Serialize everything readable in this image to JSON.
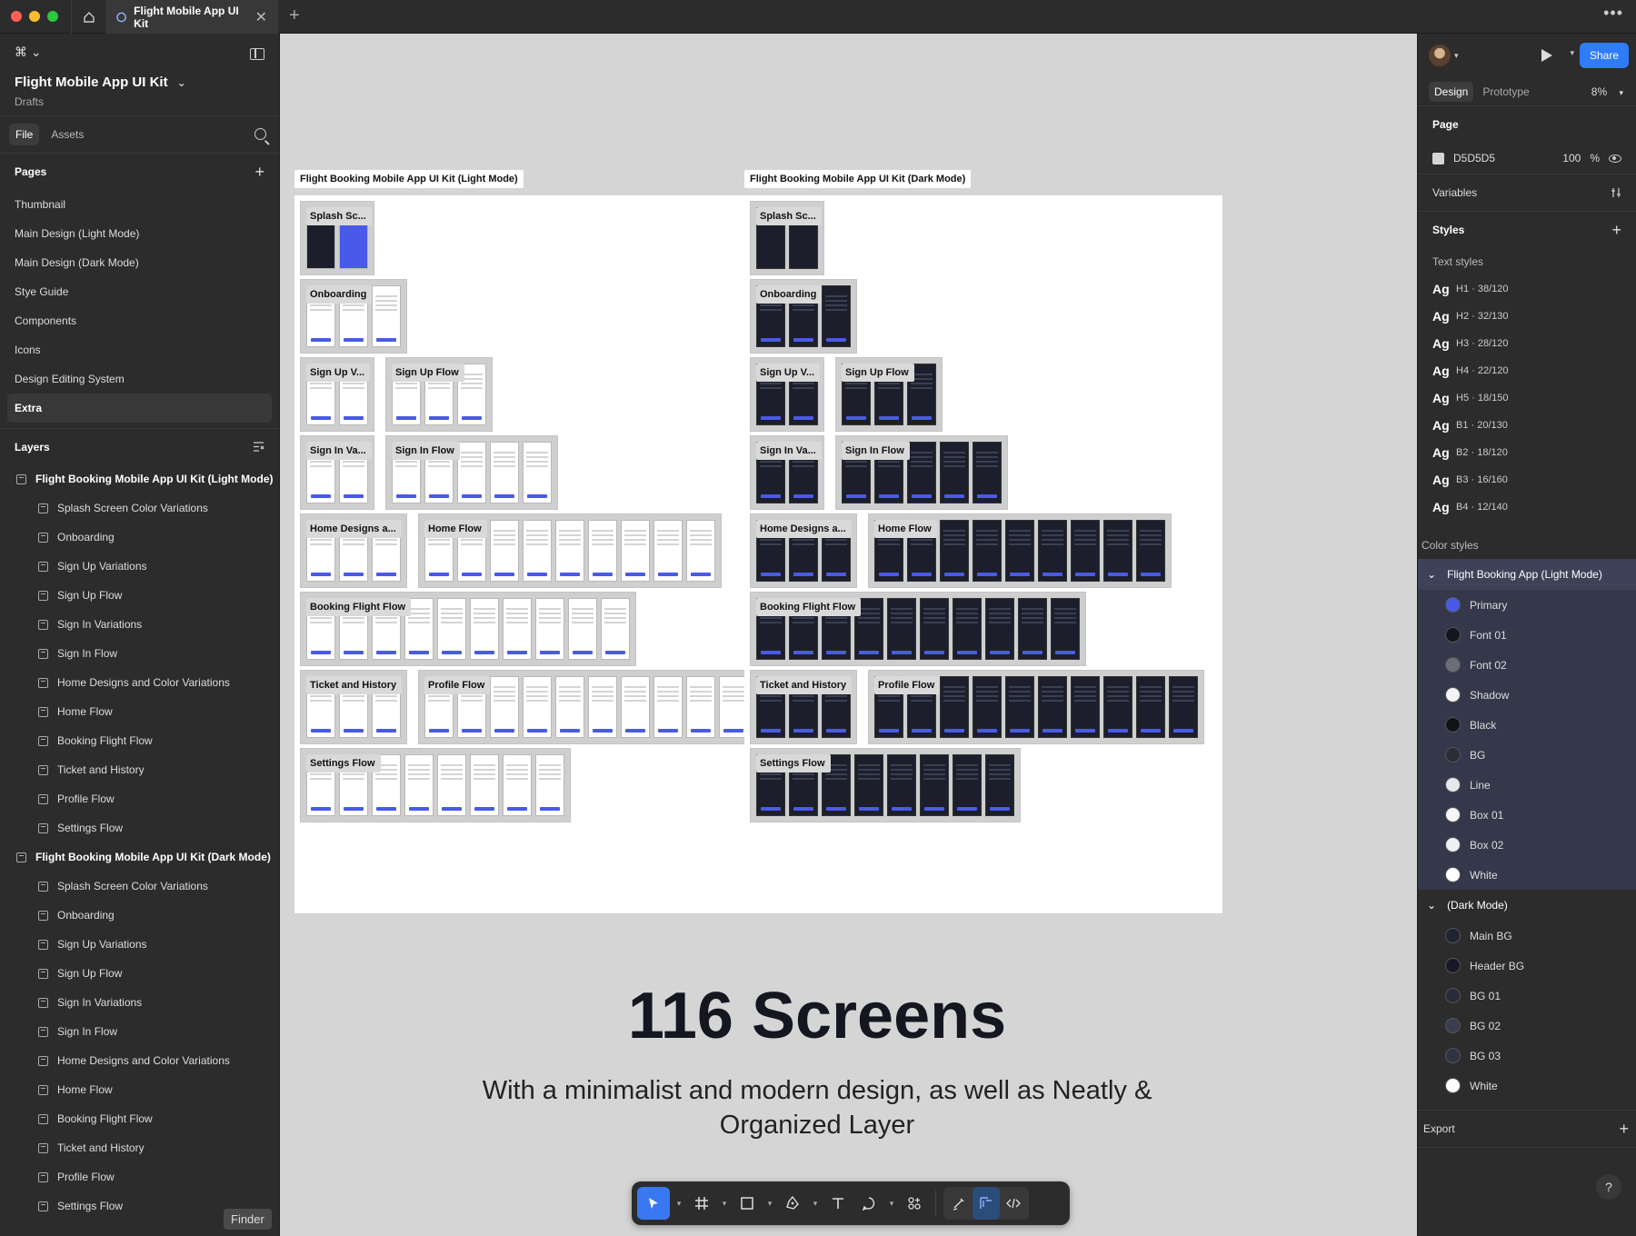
{
  "window": {
    "tab_title": "Flight Mobile App UI Kit",
    "tab_close": "✕",
    "new_tab": "+",
    "more": "•••"
  },
  "left_panel": {
    "figma_menu": "⌘ ⌄",
    "doc_title": "Flight Mobile App UI Kit",
    "doc_title_caret": "⌄",
    "doc_location": "Drafts",
    "tabs": [
      "File",
      "Assets"
    ],
    "pages_heading": "Pages",
    "pages_add": "+",
    "pages": [
      "Thumbnail",
      "Main Design (Light Mode)",
      "Main Design (Dark Mode)",
      "Stye Guide",
      "Components",
      "Icons",
      "Design Editing System",
      "Extra"
    ],
    "active_page": "Extra",
    "layers_heading": "Layers",
    "layers": [
      {
        "name": "Flight Booking Mobile App UI Kit (Light Mode)",
        "children": [
          "Splash Screen Color Variations",
          "Onboarding",
          "Sign Up Variations",
          "Sign Up Flow",
          "Sign In Variations",
          "Sign In Flow",
          "Home Designs and Color Variations",
          "Home Flow",
          "Booking Flight Flow",
          "Ticket and History",
          "Profile Flow",
          "Settings Flow"
        ]
      },
      {
        "name": "Flight Booking Mobile App UI Kit (Dark Mode)",
        "children": [
          "Splash Screen Color Variations",
          "Onboarding",
          "Sign Up Variations",
          "Sign Up Flow",
          "Sign In Variations",
          "Sign In Flow",
          "Home Designs and Color Variations",
          "Home Flow",
          "Booking Flight Flow",
          "Ticket and History",
          "Profile Flow",
          "Settings Flow"
        ]
      }
    ],
    "tooltip": "Finder"
  },
  "canvas": {
    "boards": [
      {
        "label": "Flight Booking Mobile App UI Kit (Light Mode)",
        "rows": [
          [
            {
              "label": "Splash Sc...",
              "screens": 2
            }
          ],
          [
            {
              "label": "Onboarding",
              "screens": 3
            }
          ],
          [
            {
              "label": "Sign Up V...",
              "screens": 2
            },
            {
              "label": "Sign Up Flow",
              "screens": 3
            }
          ],
          [
            {
              "label": "Sign In Va...",
              "screens": 2
            },
            {
              "label": "Sign In Flow",
              "screens": 5
            }
          ],
          [
            {
              "label": "Home Designs a...",
              "screens": 3
            },
            {
              "label": "Home Flow",
              "screens": 9
            }
          ],
          [
            {
              "label": "Booking Flight Flow",
              "screens": 10
            }
          ],
          [
            {
              "label": "Ticket and History",
              "screens": 3
            },
            {
              "label": "Profile Flow",
              "screens": 10
            }
          ],
          [
            {
              "label": "Settings Flow",
              "screens": 8
            }
          ]
        ]
      },
      {
        "label": "Flight Booking Mobile App UI Kit (Dark Mode)",
        "rows": [
          [
            {
              "label": "Splash Sc...",
              "screens": 2
            }
          ],
          [
            {
              "label": "Onboarding",
              "screens": 3
            }
          ],
          [
            {
              "label": "Sign Up V...",
              "screens": 2
            },
            {
              "label": "Sign Up Flow",
              "screens": 3
            }
          ],
          [
            {
              "label": "Sign In Va...",
              "screens": 2
            },
            {
              "label": "Sign In Flow",
              "screens": 5
            }
          ],
          [
            {
              "label": "Home Designs a...",
              "screens": 3
            },
            {
              "label": "Home Flow",
              "screens": 9
            }
          ],
          [
            {
              "label": "Booking Flight Flow",
              "screens": 10
            }
          ],
          [
            {
              "label": "Ticket and History",
              "screens": 3
            },
            {
              "label": "Profile Flow",
              "screens": 10
            }
          ],
          [
            {
              "label": "Settings Flow",
              "screens": 8
            }
          ]
        ]
      }
    ],
    "headline": "116 Screens",
    "subline": "With a minimalist and modern design, as well as Neatly & Organized Layer"
  },
  "toolbar": {
    "tools": [
      "move-tool",
      "frame-tool",
      "shape-tool",
      "pen-tool",
      "text-tool",
      "comment-tool",
      "actions-tool"
    ],
    "active": "move-tool",
    "mode_tools": [
      "draw-mode",
      "design-mode",
      "dev-mode"
    ]
  },
  "right_panel": {
    "share": "Share",
    "tabs": [
      "Design",
      "Prototype"
    ],
    "zoom": "8%",
    "page_heading": "Page",
    "page_color": "D5D5D5",
    "page_opacity": "100",
    "page_opacity_unit": "%",
    "variables_heading": "Variables",
    "styles_heading": "Styles",
    "text_styles_heading": "Text styles",
    "text_styles": [
      {
        "ag": "Ag",
        "name": "H1 · 38/120"
      },
      {
        "ag": "Ag",
        "name": "H2 · 32/130"
      },
      {
        "ag": "Ag",
        "name": "H3 · 28/120"
      },
      {
        "ag": "Ag",
        "name": "H4 · 22/120"
      },
      {
        "ag": "Ag",
        "name": "H5 · 18/150"
      },
      {
        "ag": "Ag",
        "name": "B1 · 20/130"
      },
      {
        "ag": "Ag",
        "name": "B2 · 18/120"
      },
      {
        "ag": "Ag",
        "name": "B3 · 16/160"
      },
      {
        "ag": "Ag",
        "name": "B4 · 12/140"
      }
    ],
    "color_styles_heading": "Color styles",
    "color_groups": [
      {
        "name": "Flight Booking App (Light Mode)",
        "colors": [
          {
            "name": "Primary",
            "hex": "#4a5ae8"
          },
          {
            "name": "Font 01",
            "hex": "#14171f"
          },
          {
            "name": "Font 02",
            "hex": "#6b6e78"
          },
          {
            "name": "Shadow",
            "hex": "#f4f4f6"
          },
          {
            "name": "Black",
            "hex": "#111318"
          },
          {
            "name": "BG",
            "hex": "#2a2d38"
          },
          {
            "name": "Line",
            "hex": "#e6e8ee"
          },
          {
            "name": "Box 01",
            "hex": "#f7f7f9"
          },
          {
            "name": "Box 02",
            "hex": "#eef0f5"
          },
          {
            "name": "White",
            "hex": "#ffffff"
          }
        ]
      },
      {
        "name": "(Dark Mode)",
        "colors": [
          {
            "name": "Main BG",
            "hex": "#1f2230"
          },
          {
            "name": "Header BG",
            "hex": "#171a26"
          },
          {
            "name": "BG 01",
            "hex": "#282b38"
          },
          {
            "name": "BG 02",
            "hex": "#3a3e4e"
          },
          {
            "name": "BG 03",
            "hex": "#2f3342"
          },
          {
            "name": "White",
            "hex": "#ffffff"
          }
        ]
      }
    ],
    "export_heading": "Export",
    "help": "?"
  }
}
